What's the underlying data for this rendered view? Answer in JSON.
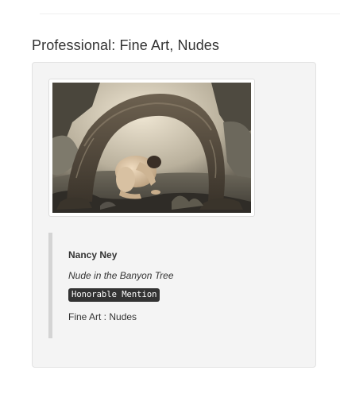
{
  "section": {
    "title": "Professional: Fine Art, Nudes"
  },
  "entry": {
    "image_alt": "Nude in the Banyon Tree",
    "artist": "Nancy Ney",
    "title": "Nude in the Banyon Tree",
    "award": "Honorable Mention",
    "category": "Fine Art : Nudes"
  },
  "colors": {
    "badge_bg": "#333333",
    "card_bg": "#f4f4f4",
    "quote_border": "#d4d4d4"
  }
}
